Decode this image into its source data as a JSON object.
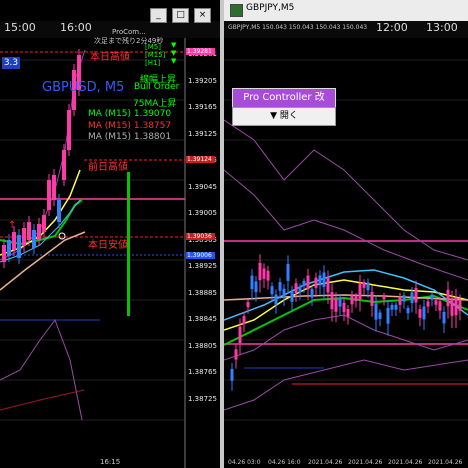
{
  "left": {
    "times": [
      "15:00",
      "16:00"
    ],
    "symbol_label": "GBPUSD, M5",
    "countdown_text": "次足まで残り2分49秒",
    "header_small": "ProCom...",
    "badge_text": "3.3",
    "tf_labels": [
      "[M5]",
      "[M15]",
      "[H1]"
    ],
    "labels": {
      "today_high": "本日高値",
      "trend": "線幅上昇",
      "order": "Bull Order",
      "ma_up": "75MA上昇",
      "prev_high": "前日高値",
      "today_low": "本日安値"
    },
    "ma_lines": [
      {
        "text": "MA (M15)  1.39070",
        "color": "#00ff00"
      },
      {
        "text": "MA (M15)  1.38757",
        "color": "#ff3030"
      },
      {
        "text": "MA (M15)  1.38801",
        "color": "#b0b0b0"
      }
    ],
    "prices": [
      "1.39281",
      "1.39205",
      "1.39165",
      "1.39125",
      "1.39085",
      "1.39045",
      "1.39005",
      "1.38965",
      "1.38925",
      "1.38885",
      "1.38845",
      "1.38805",
      "1.38765",
      "1.38725"
    ],
    "tags": [
      "1.39281",
      "1.39124",
      "1.39036",
      "1.39006"
    ],
    "bottom_time": "16:15",
    "window_controls": [
      "_",
      "□",
      "×"
    ]
  },
  "right": {
    "title": "GBPJPY,M5",
    "info": "GBPJPY,M5  150.043 150.043 150.043 150.043",
    "times": [
      "12:00",
      "13:00"
    ],
    "pc_title": "Pro Controller 改",
    "pc_open": "▼ 開く",
    "dates": [
      "04.26 03:0",
      "04.26 16:0",
      "2021.04.26",
      "2021.04.26",
      "2021.04.26",
      "2021.04.26"
    ]
  },
  "colors": {
    "bull": "#ff3aa8",
    "bear": "#3080ff",
    "magenta": "#ff3aa8",
    "red": "#ff2020",
    "green": "#00c800",
    "band": "#9a4aa6",
    "purple": "#a64cd9"
  }
}
